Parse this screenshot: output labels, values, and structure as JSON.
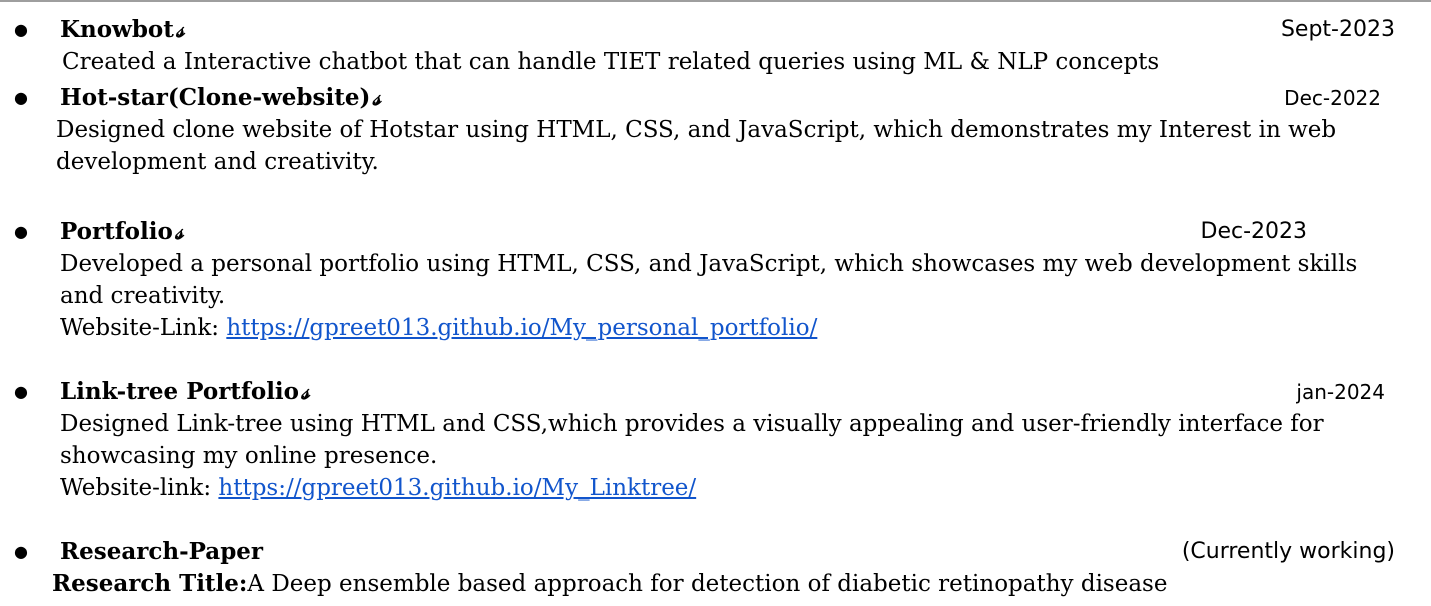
{
  "link_glyph": "𝓈",
  "projects": [
    {
      "title": "Knowbot",
      "date": "Sept-2023",
      "desc": "Created a Interactive chatbot that can handle TIET related queries using ML & NLP concepts"
    },
    {
      "title": "Hot-star(Clone-website)",
      "date": "Dec-2022",
      "desc": "Designed clone website of Hotstar using HTML, CSS, and JavaScript, which demonstrates my Interest in web development and creativity."
    },
    {
      "title": "Portfolio",
      "date": "Dec-2023",
      "desc": "Developed a personal portfolio using HTML, CSS, and JavaScript, which showcases my web development skills and creativity.",
      "link_label": "Website-Link: ",
      "url": "https://gpreet013.github.io/My_personal_portfolio/"
    },
    {
      "title": "Link-tree Portfolio",
      "date": "jan-2024",
      "desc": "Designed Link-tree using HTML and CSS,which provides a visually appealing and user-friendly interface for showcasing my online presence.",
      "link_label": "Website-link: ",
      "url": "https://gpreet013.github.io/My_Linktree/"
    },
    {
      "title": "Research-Paper",
      "date": "(Currently working)",
      "research_label": "Research Title:",
      "research_title": "A Deep ensemble based approach for detection of diabetic retinopathy disease"
    }
  ]
}
